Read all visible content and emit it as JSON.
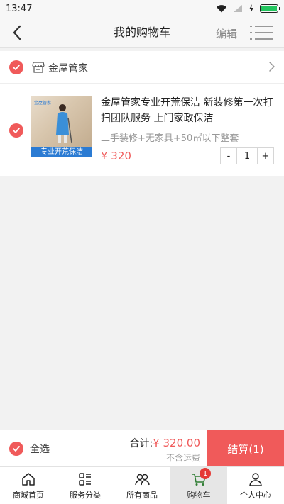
{
  "status": {
    "time": "13:47"
  },
  "header": {
    "title": "我的购物车",
    "edit_label": "编辑"
  },
  "shop": {
    "name": "金屋管家"
  },
  "item": {
    "title": "金屋管家专业开荒保洁 新装修第一次打扫团队服务 上门家政保洁",
    "spec": "二手装修+无家具+50㎡以下整套",
    "price": "¥ 320",
    "quantity": "1",
    "minus": "-",
    "plus": "+",
    "image_banner": "专业开荒保洁",
    "image_logo": "金屋管家"
  },
  "checkout": {
    "select_all": "全选",
    "total_label": "合计:",
    "total_amount": "¥ 320.00",
    "shipping_note": "不含运费",
    "settle_label": "结算(1)"
  },
  "tabs": [
    {
      "label": "商城首页",
      "icon": "home-icon"
    },
    {
      "label": "服务分类",
      "icon": "category-icon"
    },
    {
      "label": "所有商品",
      "icon": "users-icon"
    },
    {
      "label": "购物车",
      "icon": "cart-icon",
      "badge": "1"
    },
    {
      "label": "个人中心",
      "icon": "person-icon"
    }
  ],
  "colors": {
    "accent": "#f05a5a",
    "badge": "#e53935"
  }
}
